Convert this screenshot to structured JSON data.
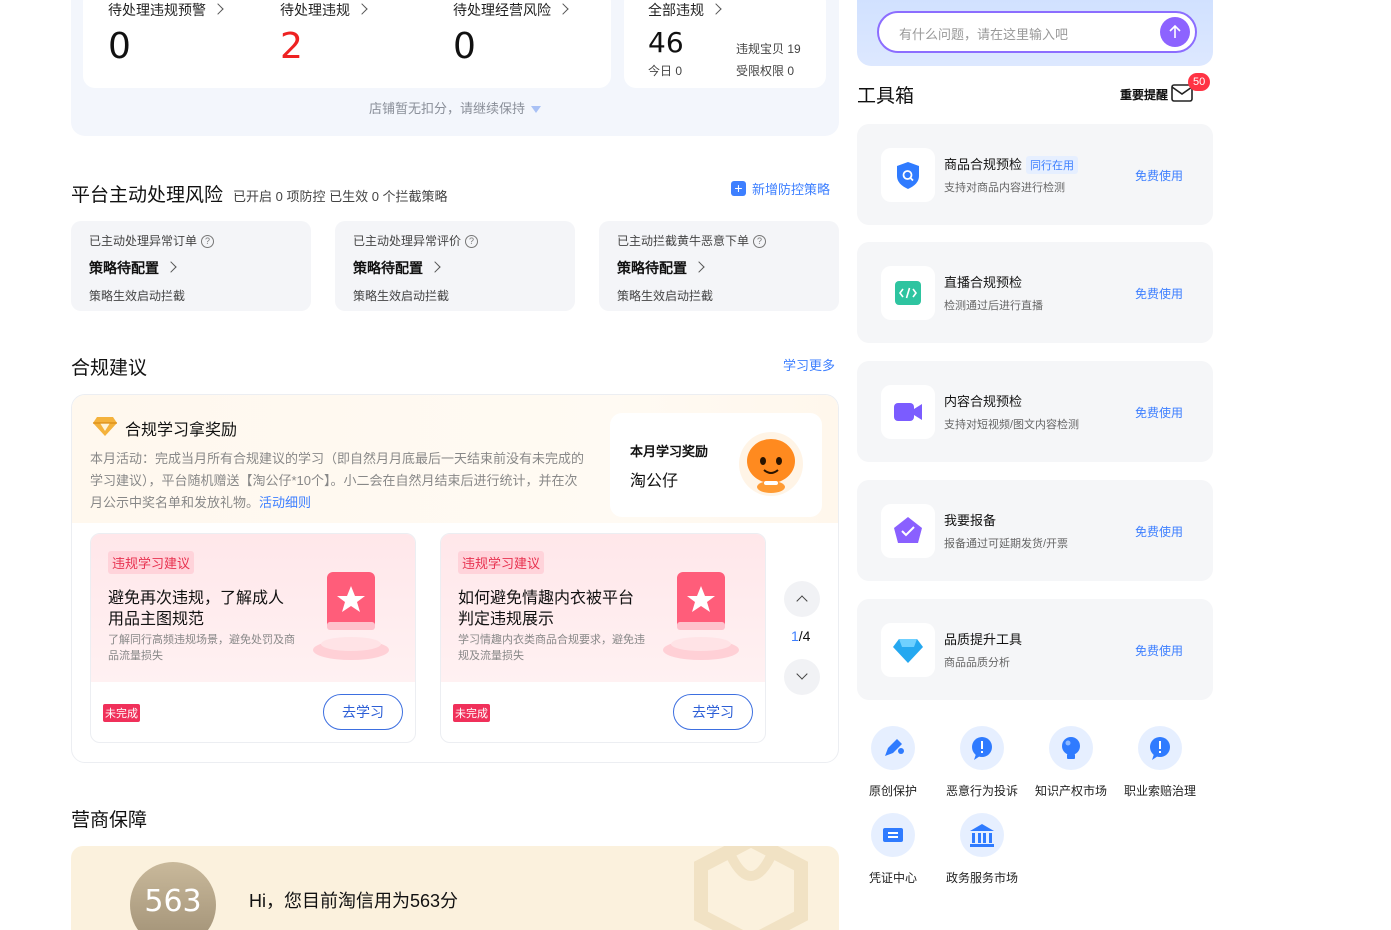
{
  "stats": {
    "items": [
      {
        "label": "待处理违规预警",
        "value": "0"
      },
      {
        "label": "待处理违规",
        "value": "2"
      },
      {
        "label": "待处理经营风险",
        "value": "0"
      }
    ],
    "all": {
      "label": "全部违规",
      "value": "46",
      "today": "今日 0",
      "baby": "违规宝贝 19",
      "limit": "受限权限 0"
    },
    "note": "店铺暂无扣分，请继续保持"
  },
  "platform": {
    "title": "平台主动处理风险",
    "subtitle": "已开启 0 项防控 已生效 0 个拦截策略",
    "add_label": "新增防控策略",
    "cards": [
      {
        "title": "已主动处理异常订单",
        "status": "策略待配置",
        "note": "策略生效启动拦截"
      },
      {
        "title": "已主动处理异常评价",
        "status": "策略待配置",
        "note": "策略生效启动拦截"
      },
      {
        "title": "已主动拦截黄牛恶意下单",
        "status": "策略待配置",
        "note": "策略生效启动拦截"
      }
    ]
  },
  "advice": {
    "title": "合规建议",
    "more": "学习更多",
    "reward_title": "合规学习拿奖励",
    "reward_desc": "本月活动：完成当月所有合规建议的学习（即自然月月底最后一天结束前没有未完成的学习建议），平台随机赠送【淘公仔*10个】。小二会在自然月结束后进行统计，并在次月公示中奖名单和发放礼物。",
    "reward_link": "活动细则",
    "prize_label": "本月学习奖励",
    "prize_name": "淘公仔",
    "cards": [
      {
        "tag": "违规学习建议",
        "title": "避免再次违规，了解成人用品主图规范",
        "desc": "了解同行高频违规场景，避免处罚及商品流量损失",
        "status": "未完成",
        "btn": "去学习"
      },
      {
        "tag": "违规学习建议",
        "title": "如何避免情趣内衣被平台判定违规展示",
        "desc": "学习情趣内衣类商品合规要求，避免违规及流量损失",
        "status": "未完成",
        "btn": "去学习"
      }
    ],
    "page_current": "1",
    "page_total": "/4"
  },
  "guarantee": {
    "title": "营商保障",
    "score": "563",
    "msg": "Hi，您目前淘信用为563分"
  },
  "ask": {
    "placeholder": "有什么问题，请在这里输入吧"
  },
  "toolbox": {
    "title": "工具箱",
    "remind": "重要提醒",
    "badge": "50",
    "tools": [
      {
        "name": "商品合规预检",
        "peer": "同行在用",
        "desc": "支持对商品内容进行检测",
        "use": "免费使用",
        "icon": "shield-search-icon",
        "color": "#2f7bff"
      },
      {
        "name": "直播合规预检",
        "peer": "",
        "desc": "检测通过后进行直播",
        "use": "免费使用",
        "icon": "code-icon",
        "color": "#2ec4a0"
      },
      {
        "name": "内容合规预检",
        "peer": "",
        "desc": "支持对短视频/图文内容检测",
        "use": "免费使用",
        "icon": "video-icon",
        "color": "#7b5cff"
      },
      {
        "name": "我要报备",
        "peer": "",
        "desc": "报备通过可延期发货/开票",
        "use": "免费使用",
        "icon": "report-icon",
        "color": "#8a60ff"
      },
      {
        "name": "品质提升工具",
        "peer": "",
        "desc": "商品品质分析",
        "use": "免费使用",
        "icon": "diamond-icon",
        "color": "#25a8f0"
      }
    ]
  },
  "quick": [
    {
      "label": "原创保护",
      "icon": "pen-icon"
    },
    {
      "label": "恶意行为投诉",
      "icon": "alert-icon"
    },
    {
      "label": "知识产权市场",
      "icon": "bulb-icon"
    },
    {
      "label": "职业索赔治理",
      "icon": "alert-icon"
    },
    {
      "label": "凭证中心",
      "icon": "ticket-icon"
    },
    {
      "label": "政务服务市场",
      "icon": "bank-icon"
    }
  ]
}
